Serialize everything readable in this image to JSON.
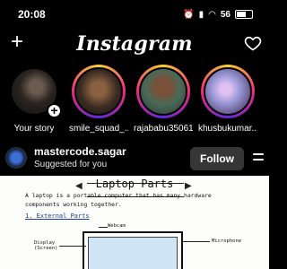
{
  "status": {
    "time": "20:08",
    "battery": "56"
  },
  "header": {
    "title": "Instagram"
  },
  "stories": [
    {
      "name": "Your story"
    },
    {
      "name": "smile_squad_..."
    },
    {
      "name": "rajababu35061"
    },
    {
      "name": "khusbukumar..."
    }
  ],
  "post": {
    "username": "mastercode.sagar",
    "subtitle": "Suggested for you",
    "follow_label": "Follow",
    "image": {
      "title": "Laptop Parts",
      "intro": "A laptop is a portable computer that has many hardware components working together.",
      "heading": "1. External Parts",
      "label_webcam": "Webcam",
      "label_display": "Display (Screen)",
      "label_mic": "Microphone"
    }
  }
}
